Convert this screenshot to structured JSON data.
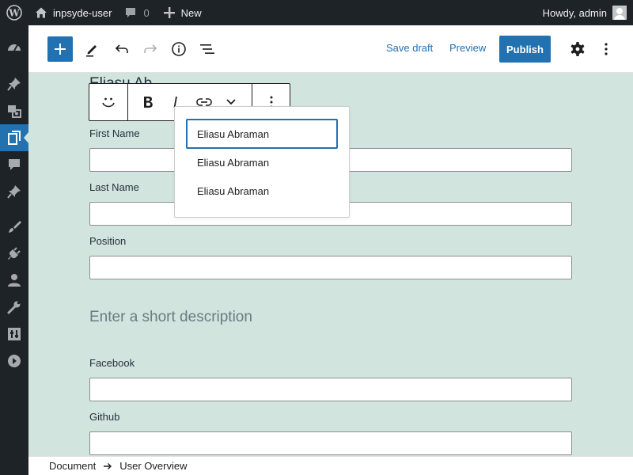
{
  "admin_bar": {
    "site_name": "inpsyde-user",
    "comment_count": "0",
    "new_label": "New",
    "greeting": "Howdy, admin"
  },
  "side_menu": {
    "icons": [
      "dashboard-icon",
      "posts-pin-icon",
      "media-icon",
      "pages-icon",
      "comments-icon",
      "custom-post-pin-icon",
      "appearance-icon",
      "plugins-icon",
      "users-icon",
      "tools-icon",
      "settings-icon",
      "collapse-icon"
    ],
    "active": "pages-icon"
  },
  "editor_header": {
    "save_draft": "Save draft",
    "preview": "Preview",
    "publish": "Publish"
  },
  "form": {
    "clipped_title": "Eliasu Ab",
    "fields": [
      {
        "label": "First Name",
        "value": ""
      },
      {
        "label": "Last Name",
        "value": ""
      },
      {
        "label": "Position",
        "value": ""
      }
    ],
    "description_placeholder": "Enter a short description",
    "social_fields": [
      {
        "label": "Facebook",
        "value": ""
      },
      {
        "label": "Github",
        "value": ""
      }
    ]
  },
  "autocomplete": {
    "suggestions": [
      "Eliasu Abraman",
      "Eliasu Abraman",
      "Eliasu Abraman"
    ],
    "selected_index": 0
  },
  "footer": {
    "breadcrumb": [
      "Document",
      "User Overview"
    ]
  },
  "colors": {
    "accent": "#2271b1",
    "admin_bar": "#1d2327",
    "canvas_background": "#d1e4dd"
  }
}
